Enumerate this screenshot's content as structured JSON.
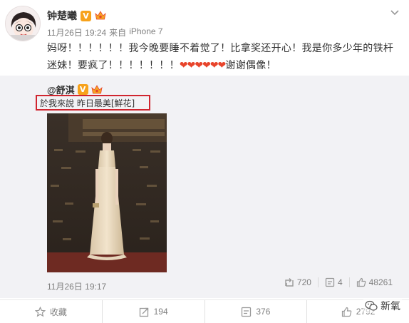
{
  "post": {
    "author": "钟楚曦",
    "verified_badge": "V",
    "meta_time": "11月26日 19:24",
    "meta_source_prefix": "来自",
    "meta_source": "iPhone 7",
    "text": "妈呀！！！！！！我今晚要睡不着觉了！比拿奖还开心！我是你多少年的铁杆迷妹！要疯了！！！！！！！",
    "hearts": "❤❤❤❤❤❤",
    "text_end": "谢谢偶像！"
  },
  "retweet": {
    "author": "@舒淇",
    "verified_badge": "V",
    "text": "於我來說 昨日最美[鮮花]",
    "time": "11月26日 19:17",
    "stats": {
      "reposts": "720",
      "comments": "4",
      "likes": "48261"
    }
  },
  "actions": {
    "favorite": "收藏",
    "repost": "194",
    "comment": "376",
    "like": "2792"
  },
  "watermark": "新氧",
  "colors": {
    "accent_red": "#d0252f",
    "heart_red": "#e8442b",
    "verified_orange": "#f7a21b",
    "meta_gray": "#808080"
  }
}
